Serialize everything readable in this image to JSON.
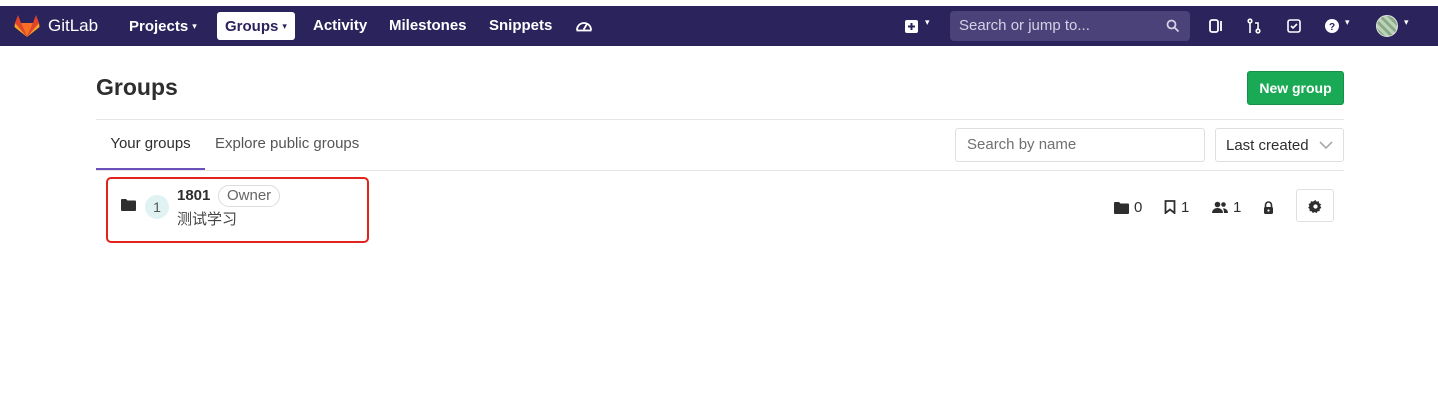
{
  "navbar": {
    "brand": "GitLab",
    "items": [
      {
        "label": "Projects",
        "has_caret": true
      },
      {
        "label": "Groups",
        "has_caret": true,
        "active": true
      },
      {
        "label": "Activity"
      },
      {
        "label": "Milestones"
      },
      {
        "label": "Snippets"
      }
    ],
    "search_placeholder": "Search or jump to...",
    "icons": [
      "dashboard-icon",
      "plus-square-icon",
      "todo-list-icon",
      "merge-request-icon",
      "issues-check-icon",
      "help-icon"
    ],
    "colors": {
      "background": "#2b235c",
      "active_tab_bg": "#ffffff"
    }
  },
  "page": {
    "title": "Groups",
    "new_group_label": "New group",
    "tabs": [
      {
        "label": "Your groups",
        "active": true
      },
      {
        "label": "Explore public groups",
        "active": false
      }
    ],
    "filter_placeholder": "Search by name",
    "sort_label": "Last created"
  },
  "groups": [
    {
      "avatar_letter": "1",
      "name": "1801",
      "role": "Owner",
      "description": "测试学习",
      "subgroups_count": "0",
      "projects_count": "1",
      "members_count": "1",
      "visibility_icon": "lock-icon"
    }
  ],
  "colors": {
    "accent_green": "#1aaa55",
    "tab_underline": "#6b4fbb",
    "highlight_border": "#e0231b"
  }
}
